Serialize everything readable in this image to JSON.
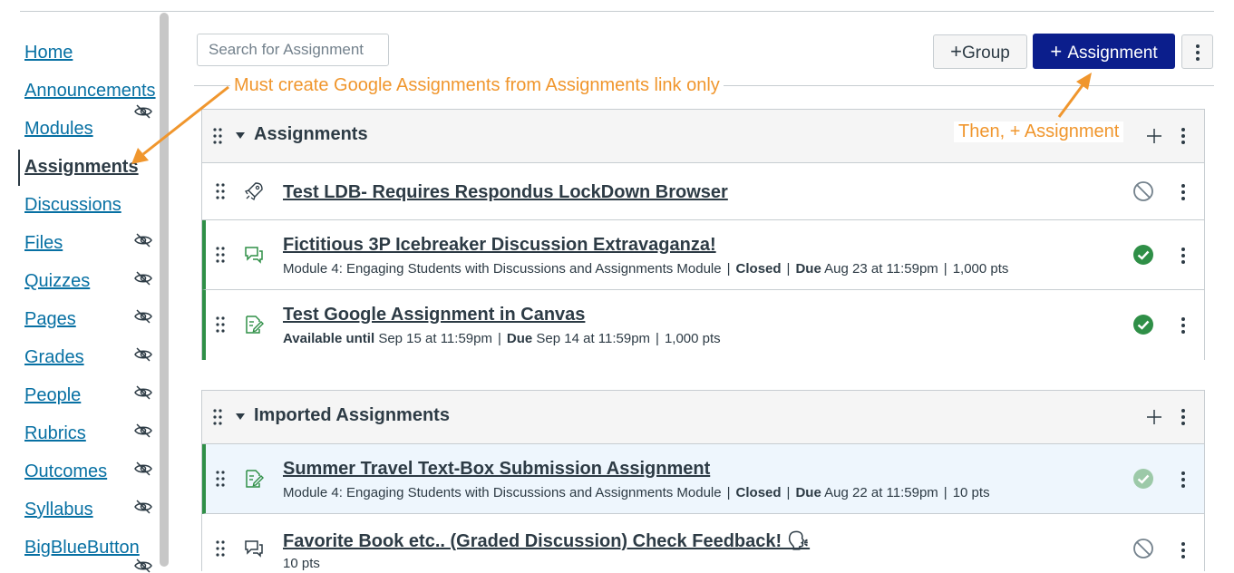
{
  "sidebar": {
    "items": [
      {
        "label": "Home",
        "hidden": false,
        "active": false
      },
      {
        "label": "Announcements",
        "hidden": true,
        "active": false
      },
      {
        "label": "Modules",
        "hidden": false,
        "active": false
      },
      {
        "label": "Assignments",
        "hidden": false,
        "active": true
      },
      {
        "label": "Discussions",
        "hidden": false,
        "active": false
      },
      {
        "label": "Files",
        "hidden": true,
        "active": false
      },
      {
        "label": "Quizzes",
        "hidden": true,
        "active": false
      },
      {
        "label": "Pages",
        "hidden": true,
        "active": false
      },
      {
        "label": "Grades",
        "hidden": true,
        "active": false
      },
      {
        "label": "People",
        "hidden": true,
        "active": false
      },
      {
        "label": "Rubrics",
        "hidden": true,
        "active": false
      },
      {
        "label": "Outcomes",
        "hidden": true,
        "active": false
      },
      {
        "label": "Syllabus",
        "hidden": true,
        "active": false
      },
      {
        "label": "BigBlueButton",
        "hidden": true,
        "active": false
      }
    ]
  },
  "toolbar": {
    "search_placeholder": "Search for Assignment",
    "group_button": "Group",
    "assignment_button": "Assignment"
  },
  "annotations": {
    "note1": "Must create Google Assignments from Assignments link only",
    "note2": "Then, + Assignment"
  },
  "groups": [
    {
      "title": "Assignments",
      "rows": [
        {
          "type": "quiz",
          "title": "Test LDB- Requires Respondus LockDown Browser",
          "status": "unpublished",
          "meta": []
        },
        {
          "type": "discussion",
          "title": "Fictitious 3P Icebreaker Discussion Extravaganza!",
          "status": "published",
          "meta": [
            "Module 4: Engaging Students with Discussions and Assignments Module",
            "Closed",
            "Due",
            "Aug 23 at 11:59pm",
            "1,000 pts"
          ]
        },
        {
          "type": "assignment",
          "title": "Test Google Assignment in Canvas",
          "status": "published",
          "meta": [
            "Available until",
            "Sep 15 at 11:59pm",
            "Due",
            "Sep 14 at 11:59pm",
            "1,000 pts"
          ]
        }
      ]
    },
    {
      "title": "Imported Assignments",
      "rows": [
        {
          "type": "assignment",
          "title": "Summer Travel Text-Box Submission Assignment",
          "status": "published-light",
          "meta": [
            "Module 4: Engaging Students with Discussions and Assignments Module",
            "Closed",
            "Due",
            "Aug 22 at 11:59pm",
            "10 pts"
          ]
        },
        {
          "type": "discussion",
          "title": "Favorite Book etc.. (Graded Discussion) Check Feedback! 🗣",
          "status": "unpublished",
          "meta": [
            "10 pts"
          ]
        }
      ]
    }
  ],
  "colors": {
    "link": "#0770a3",
    "primary_button": "#0b1e8c",
    "published": "#2f8f47",
    "annotation": "#f0962d"
  }
}
